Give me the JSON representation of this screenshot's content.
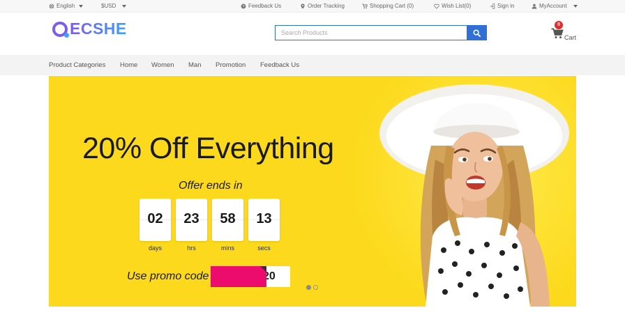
{
  "topbar": {
    "language": "English",
    "currency": "$USD",
    "feedback": "Feedback Us",
    "order_tracking": "Order Tracking",
    "shopping_cart": "Shopping Cart (0)",
    "wish_list": "Wish List(0)",
    "sign_in": "Sign in",
    "my_account": "MyAccount"
  },
  "header": {
    "logo_text": "ECSHE",
    "search_placeholder": "Search Products",
    "cart_count": "0",
    "cart_label": "Cart"
  },
  "nav": {
    "items": [
      "Product Categories",
      "Home",
      "Women",
      "Man",
      "Promotion",
      "Feedback Us"
    ]
  },
  "hero": {
    "headline": "20% Off Everything",
    "offer_text": "Offer ends in",
    "countdown": [
      {
        "value": "02",
        "unit": "days"
      },
      {
        "value": "23",
        "unit": "hrs"
      },
      {
        "value": "58",
        "unit": "mins"
      },
      {
        "value": "13",
        "unit": "secs"
      }
    ],
    "promo_label": "Use promo code",
    "promo_code_visible": "20",
    "slide_count": 2,
    "active_slide": 1
  },
  "colors": {
    "hero_bg": "#fcd91c",
    "accent_blue": "#2f6fd6",
    "promo_pink": "#ec0c6d",
    "logo_purple": "#7b5cf0",
    "badge_red": "#e52b2b"
  },
  "icons": [
    "globe-icon",
    "feedback-icon",
    "location-pin-icon",
    "cart-icon",
    "heart-icon",
    "sign-in-icon",
    "user-icon",
    "search-icon"
  ]
}
